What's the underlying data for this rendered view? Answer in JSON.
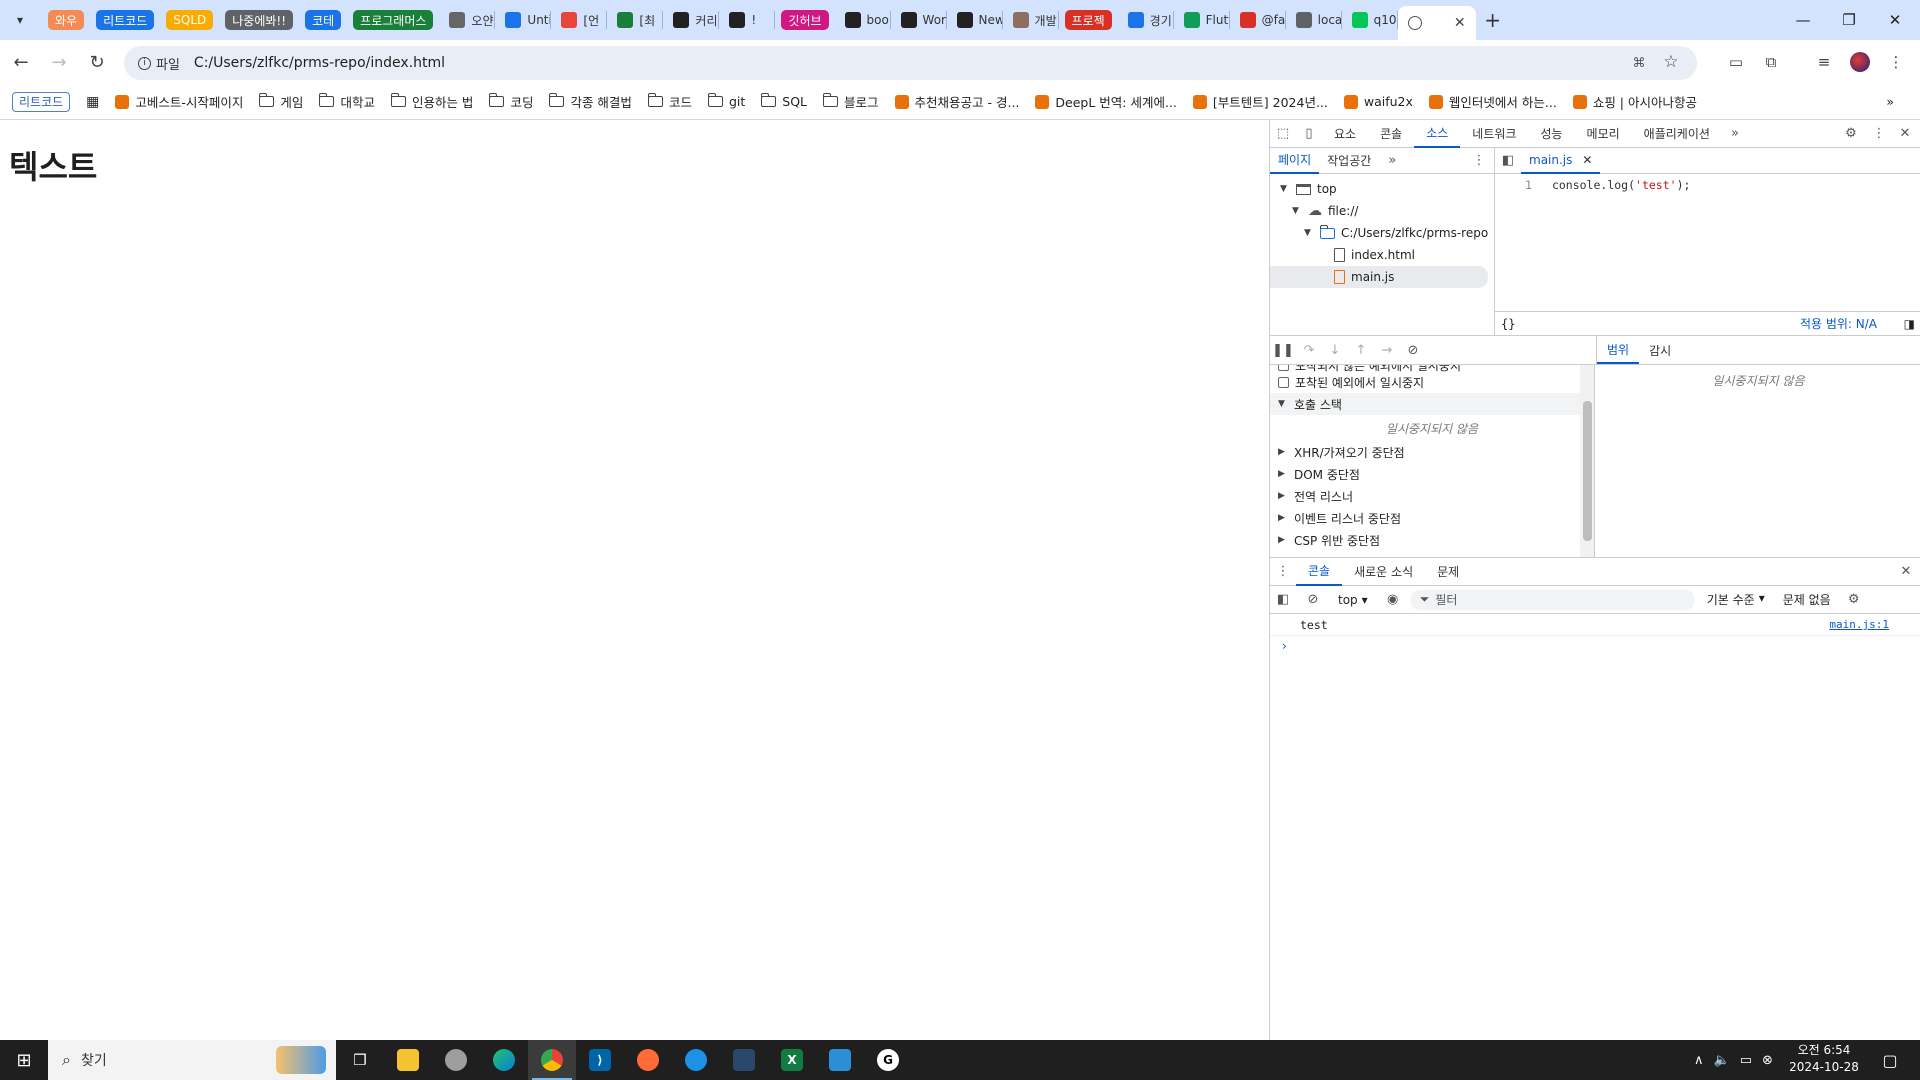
{
  "browser": {
    "tab_groups": [
      {
        "label": "와우",
        "color": "#f28b54"
      },
      {
        "label": "리트코드",
        "color": "#1a73e8"
      },
      {
        "label": "SQLD",
        "color": "#f9ab00"
      },
      {
        "label": "나중에봐!!",
        "color": "#5f6368"
      },
      {
        "label": "코테",
        "color": "#1a73e8"
      },
      {
        "label": "프로그래머스",
        "color": "#188038"
      }
    ],
    "tabs_before": [
      {
        "label": "오얀",
        "icon": "notion-icon",
        "color": "#666"
      },
      {
        "label": "Unti",
        "icon": "share-icon",
        "color": "#1a73e8"
      },
      {
        "label": "[언",
        "icon": "red-circle-icon",
        "color": "#e8453c"
      },
      {
        "label": "[최",
        "icon": "plus-green-icon",
        "color": "#188038"
      },
      {
        "label": "커리",
        "icon": "velog-icon",
        "color": "#222"
      },
      {
        "label": "!",
        "icon": "velog-icon",
        "color": "#222"
      }
    ],
    "github_group": {
      "label": "깃허브",
      "color": "#d01884"
    },
    "tabs_after": [
      {
        "label": "bool",
        "icon": "github-icon",
        "color": "#222"
      },
      {
        "label": "Wor",
        "icon": "github-icon",
        "color": "#222"
      },
      {
        "label": "New",
        "icon": "github-icon",
        "color": "#222"
      },
      {
        "label": "개발",
        "icon": "image-icon",
        "color": "#8d6e63"
      }
    ],
    "project_group": {
      "label": "프로젝",
      "color": "#d93025"
    },
    "tabs_end": [
      {
        "label": "경기",
        "icon": "globe-icon",
        "color": "#1a73e8"
      },
      {
        "label": "Flutt",
        "icon": "v-icon",
        "color": "#0f9d58"
      },
      {
        "label": "@fa",
        "icon": "square-red-icon",
        "color": "#d93025"
      },
      {
        "label": "loca",
        "icon": "globe-gray-icon",
        "color": "#5f6368"
      },
      {
        "label": "q10",
        "icon": "naver-icon",
        "color": "#03c75a"
      }
    ],
    "active_tab": {
      "label": ""
    },
    "omnibox": {
      "chip": "파일",
      "url": "C:/Users/zlfkc/prms-repo/index.html"
    },
    "bookmarks": [
      {
        "label": "리트코드",
        "type": "pill"
      },
      {
        "label": "",
        "type": "apps"
      },
      {
        "label": "고베스트-시작페이지",
        "type": "site"
      },
      {
        "label": "게임",
        "type": "folder"
      },
      {
        "label": "대학교",
        "type": "folder"
      },
      {
        "label": "인용하는 법",
        "type": "folder"
      },
      {
        "label": "코딩",
        "type": "folder"
      },
      {
        "label": "각종 해결법",
        "type": "folder"
      },
      {
        "label": "코드",
        "type": "folder"
      },
      {
        "label": "git",
        "type": "folder"
      },
      {
        "label": "SQL",
        "type": "folder"
      },
      {
        "label": "블로그",
        "type": "folder"
      },
      {
        "label": "추천채용공고 - 경...",
        "type": "site"
      },
      {
        "label": "DeepL 번역: 세계에...",
        "type": "site"
      },
      {
        "label": "[부트텐트] 2024년...",
        "type": "site"
      },
      {
        "label": "waifu2x",
        "type": "site"
      },
      {
        "label": "웹인터넷에서 하는...",
        "type": "site"
      },
      {
        "label": "쇼핑 | 아시아나항공",
        "type": "site"
      }
    ]
  },
  "page": {
    "heading": "텍스트"
  },
  "devtools": {
    "tabs": [
      "요소",
      "콘솔",
      "소스",
      "네트워크",
      "성능",
      "메모리",
      "애플리케이션"
    ],
    "active_tab": "소스",
    "nav_tabs": [
      "페이지",
      "작업공간"
    ],
    "tree": {
      "top": "top",
      "origin": "file://",
      "folder": "C:/Users/zlfkc/prms-repo",
      "files": [
        "index.html",
        "main.js"
      ]
    },
    "editor": {
      "file_tab": "main.js",
      "line_number": "1",
      "code_prefix": "console.log(",
      "code_string": "'test'",
      "code_suffix": ");",
      "coverage": "적용 범위: N/A"
    },
    "debugger": {
      "clipped_item": "포착되지 않은 예외에서 일시중지",
      "caught_item": "포착된 예외에서 일시중지",
      "call_stack": "호출 스택",
      "not_paused": "일시중지되지 않음",
      "sections": [
        "XHR/가져오기 중단점",
        "DOM 중단점",
        "전역 리스너",
        "이벤트 리스너 중단점",
        "CSP 위반 중단점"
      ],
      "right_tabs": [
        "범위",
        "감시"
      ],
      "right_empty": "일시중지되지 않음"
    },
    "drawer": {
      "tabs": [
        "콘솔",
        "새로운 소식",
        "문제"
      ],
      "context": "top",
      "filter_placeholder": "필터",
      "levels": "기본 수준",
      "issues": "문제 없음",
      "messages": [
        {
          "text": "test",
          "source": "main.js:1"
        }
      ]
    }
  },
  "taskbar": {
    "search_label": "찾기",
    "clock_time": "오전 6:54",
    "clock_date": "2024-10-28"
  }
}
